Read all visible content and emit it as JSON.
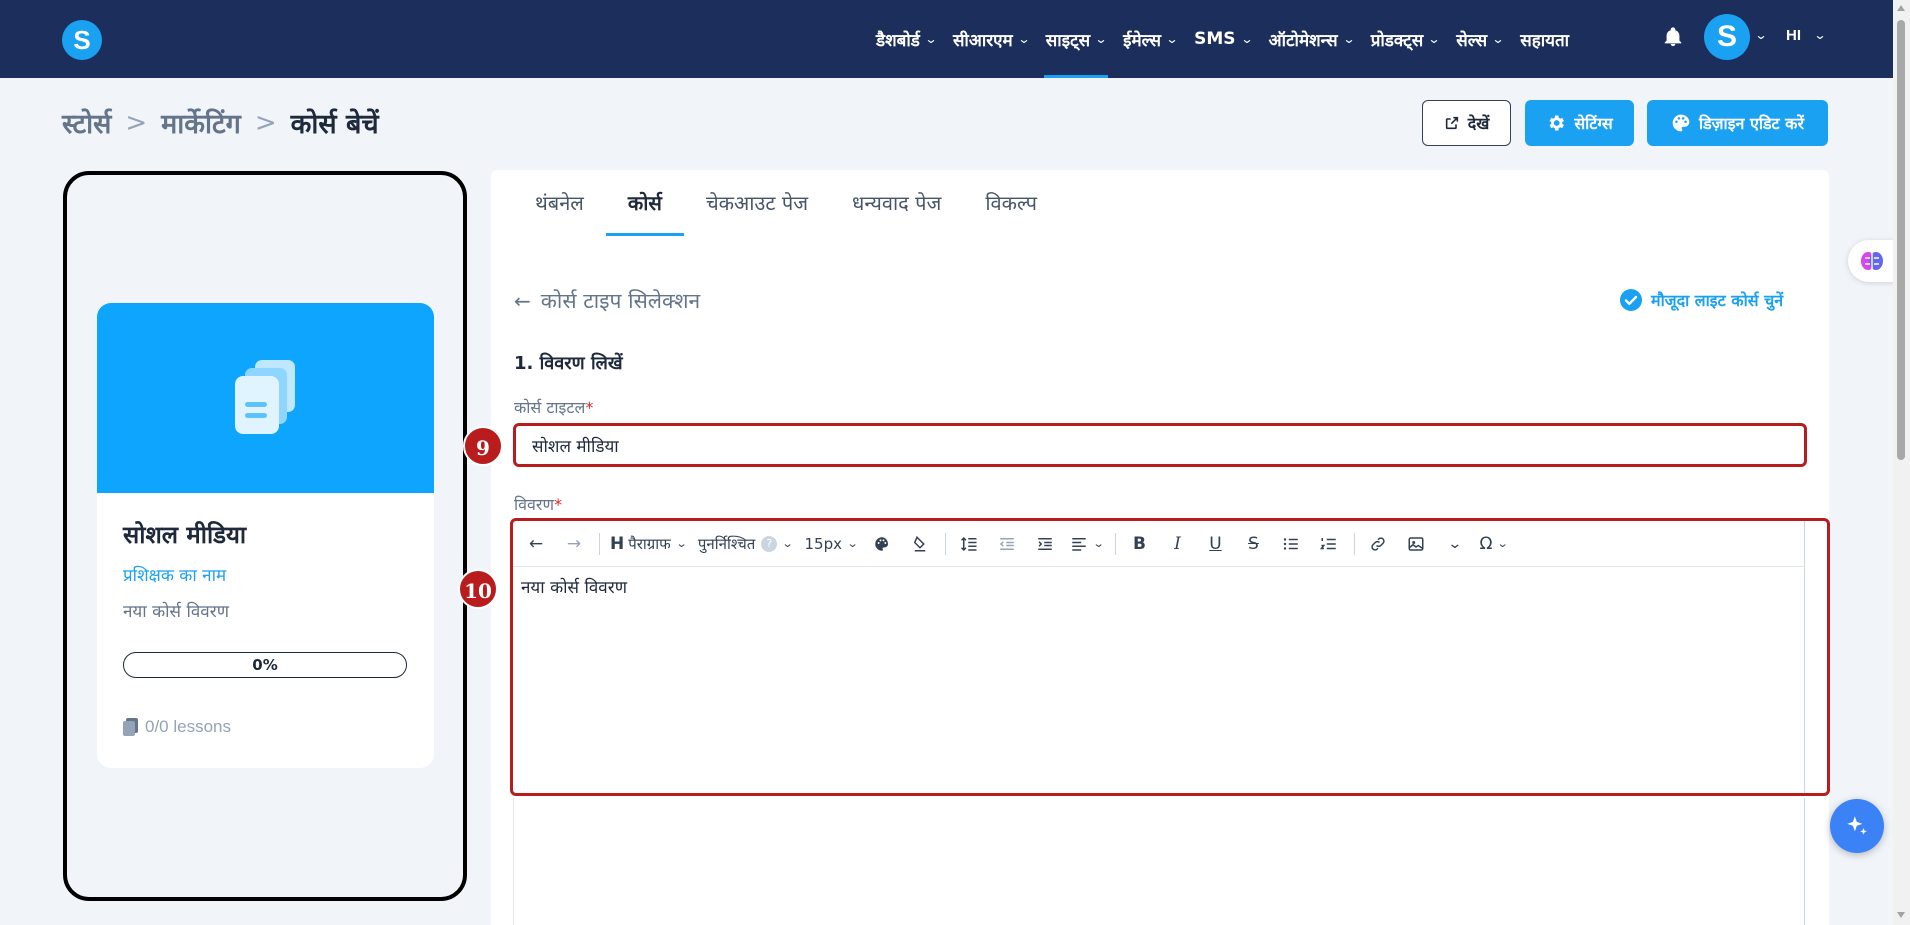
{
  "topbar": {
    "nav": [
      {
        "label": "डैशबोर्ड"
      },
      {
        "label": "सीआरएम"
      },
      {
        "label": "साइट्स"
      },
      {
        "label": "ईमेल्स"
      },
      {
        "label": "SMS"
      },
      {
        "label": "ऑटोमेशन्स"
      },
      {
        "label": "प्रोडक्ट्स"
      },
      {
        "label": "सेल्स"
      },
      {
        "label": "सहायता"
      }
    ],
    "logo_letter": "S",
    "avatar_letter": "S",
    "language": "HI",
    "active_nav": "साइट्स"
  },
  "breadcrumb": {
    "items": [
      "स्टोर्स",
      "मार्केटिंग",
      "कोर्स बेचें"
    ],
    "separator": ">"
  },
  "header_buttons": {
    "view": "देखें",
    "settings": "सेटिंग्स",
    "design": "डिज़ाइन एडिट करें"
  },
  "preview": {
    "title": "सोशल मीडिया",
    "instructor": "प्रशिक्षक का नाम",
    "description": "नया कोर्स विवरण",
    "progress": "0%",
    "lessons": "0/0 lessons"
  },
  "tabs": [
    {
      "label": "थंबनेल"
    },
    {
      "label": "कोर्स"
    },
    {
      "label": "चेकआउट पेज"
    },
    {
      "label": "धन्यवाद पेज"
    },
    {
      "label": "विकल्प"
    }
  ],
  "active_tab": "कोर्स",
  "form": {
    "back_label": "कोर्स टाइप सिलेक्शन",
    "existing_label": "मौजूदा लाइट कोर्स चुनें",
    "section_title": "1. विवरण लिखें",
    "title_label": "कोर्स टाइटल",
    "title_value": "सोशल मीडिया",
    "description_label": "विवरण",
    "description_value": "नया कोर्स विवरण",
    "required_mark": "*"
  },
  "toolbar": {
    "heading": "पैराग्राफ",
    "heading_icon": "H",
    "reuse": "पुनर्निश्चित",
    "help": "?",
    "font_size": "15px"
  },
  "steps": {
    "title_step": "9",
    "description_step": "10"
  },
  "colors": {
    "topbar": "#1c2e5b",
    "accent": "#1ba1f2",
    "highlight": "#b91c1c"
  }
}
